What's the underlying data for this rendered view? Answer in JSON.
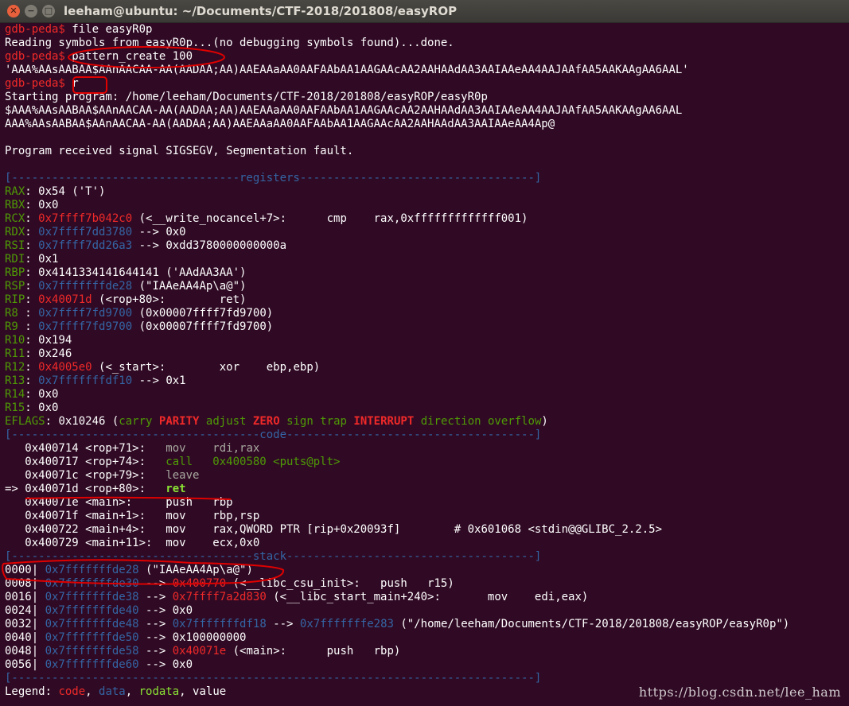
{
  "window": {
    "title": "leeham@ubuntu: ~/Documents/CTF-2018/201808/easyROP",
    "close_glyph": "✕",
    "minimize_glyph": "−",
    "maximize_glyph": "□"
  },
  "terminal": {
    "prompt": "gdb-peda$",
    "cmd1": "file easyR0p",
    "reading_symbols": "Reading symbols from easyR0p...(no debugging symbols found)...done.",
    "cmd2": "pattern_create 100",
    "pattern": "'AAA%AAsAABAA$AAnAACAA-AA(AADAA;AA)AAEAAaAA0AAFAAbAA1AAGAAcAA2AAHAAdAA3AAIAAeAA4AAJAAfAA5AAKAAgAA6AAL'",
    "cmd3": "r",
    "starting_program": "Starting program: /home/leeham/Documents/CTF-2018/201808/easyROP/easyR0p",
    "input_echo": "$AAA%AAsAABAA$AAnAACAA-AA(AADAA;AA)AAEAAaAA0AAFAAbAA1AAGAAcAA2AAHAAdAA3AAIAAeAA4AAJAAfAA5AAKAAgAA6AAL",
    "output_echo": "AAA%AAsAABAA$AAnAACAA-AA(AADAA;AA)AAEAAaAA0AAFAAbAA1AAGAAcAA2AAHAAdAA3AAIAAeAA4Ap@",
    "signal": "Program received signal SIGSEGV, Segmentation fault."
  },
  "sections": {
    "registers": "[----------------------------------registers-----------------------------------]",
    "code": "[-------------------------------------code-------------------------------------]",
    "stack": "[------------------------------------stack-------------------------------------]",
    "end": "[------------------------------------------------------------------------------]"
  },
  "registers": {
    "rax": {
      "name": "RAX",
      "val": "0x54 ('T')"
    },
    "rbx": {
      "name": "RBX",
      "val": "0x0"
    },
    "rcx": {
      "name": "RCX",
      "addr": "0x7ffff7b042c0",
      "rest": " (<__write_nocancel+7>:      cmp    rax,0xfffffffffffff001)"
    },
    "rdx": {
      "name": "RDX",
      "addr": "0x7ffff7dd3780",
      "rest": " --> 0x0"
    },
    "rsi": {
      "name": "RSI",
      "addr": "0x7ffff7dd26a3",
      "rest": " --> 0xdd3780000000000a"
    },
    "rdi": {
      "name": "RDI",
      "val": "0x1"
    },
    "rbp": {
      "name": "RBP",
      "val": "0x4141334141644141 ('AAdAA3AA')"
    },
    "rsp": {
      "name": "RSP",
      "addr": "0x7fffffffde28",
      "rest": " (\"IAAeAA4Ap\\a@\")"
    },
    "rip": {
      "name": "RIP",
      "addr": "0x40071d",
      "rest": " (<rop+80>:        ret)"
    },
    "r8": {
      "name": "R8 ",
      "addr": "0x7ffff7fd9700",
      "rest": " (0x00007ffff7fd9700)"
    },
    "r9": {
      "name": "R9 ",
      "addr": "0x7ffff7fd9700",
      "rest": " (0x00007ffff7fd9700)"
    },
    "r10": {
      "name": "R10",
      "val": "0x194"
    },
    "r11": {
      "name": "R11",
      "val": "0x246"
    },
    "r12": {
      "name": "R12",
      "addr": "0x4005e0",
      "rest": " (<_start>:        xor    ebp,ebp)"
    },
    "r13": {
      "name": "R13",
      "addr": "0x7fffffffdf10",
      "rest": " --> 0x1"
    },
    "r14": {
      "name": "R14",
      "val": "0x0"
    },
    "r15": {
      "name": "R15",
      "val": "0x0"
    },
    "eflags": {
      "name": "EFLAGS",
      "val": "0x10246 (",
      "carry": "carry",
      "parity": "PARITY",
      "adjust": "adjust",
      "zero": "ZERO",
      "sign": "sign",
      "trap": "trap",
      "interrupt": "INTERRUPT",
      "direction": "direction",
      "overflow": "overflow",
      "close": ")"
    }
  },
  "code": {
    "l1": {
      "left": "   0x400714 <rop+71>:   ",
      "insn": "mov    rdi,rax"
    },
    "l2": {
      "left": "   0x400717 <rop+74>:   ",
      "insn": "call   0x400580 <puts@plt>"
    },
    "l3": {
      "left": "   0x40071c <rop+79>:   ",
      "insn": "leave"
    },
    "l4": {
      "left": "=> 0x40071d <rop+80>:   ",
      "insn": "ret"
    },
    "l5": {
      "left": "   0x40071e <main>:     ",
      "insn": "push   rbp"
    },
    "l6": {
      "left": "   0x40071f <main+1>:   ",
      "insn": "mov    rbp,rsp"
    },
    "l7": {
      "left": "   0x400722 <main+4>:   ",
      "insn": "mov    rax,QWORD PTR [rip+0x20093f]        # 0x601068 <stdin@@GLIBC_2.2.5>"
    },
    "l8": {
      "left": "   0x400729 <main+11>:  ",
      "insn": "mov    ecx,0x0"
    }
  },
  "stack": {
    "s0": {
      "off": "0000| ",
      "addr": "0x7fffffffde28",
      "rest": " (\"IAAeAA4Ap\\a@\")"
    },
    "s1": {
      "off": "0008| ",
      "addr": "0x7fffffffde30",
      "arrow": " --> ",
      "val": "0x400770",
      "rest": " (<__libc_csu_init>:   push   r15)"
    },
    "s2": {
      "off": "0016| ",
      "addr": "0x7fffffffde38",
      "arrow": " --> ",
      "val": "0x7ffff7a2d830",
      "rest": " (<__libc_start_main+240>:       mov    edi,eax)"
    },
    "s3": {
      "off": "0024| ",
      "addr": "0x7fffffffde40",
      "rest": " --> 0x0"
    },
    "s4": {
      "off": "0032| ",
      "addr": "0x7fffffffde48",
      "arrow": " --> ",
      "val": "0x7fffffffdf18",
      "arrow2": " --> ",
      "val2": "0x7fffffffe283",
      "rest": " (\"/home/leeham/Documents/CTF-2018/201808/easyROP/easyR0p\")"
    },
    "s5": {
      "off": "0040| ",
      "addr": "0x7fffffffde50",
      "rest": " --> 0x100000000"
    },
    "s6": {
      "off": "0048| ",
      "addr": "0x7fffffffde58",
      "arrow": " --> ",
      "val": "0x40071e",
      "rest": " (<main>:      push   rbp)"
    },
    "s7": {
      "off": "0056| ",
      "addr": "0x7fffffffde60",
      "rest": " --> 0x0"
    }
  },
  "legend": {
    "label": "Legend: ",
    "code": "code",
    "sep1": ", ",
    "data": "data",
    "sep2": ", ",
    "rodata": "rodata",
    "sep3": ", ",
    "value": "value"
  },
  "watermark": "https://blog.csdn.net/lee_ham",
  "colors": {
    "background": "#300a24",
    "prompt": "#ef2929",
    "code": "#ef2929",
    "data": "#3465a4",
    "rodata": "#8ae234",
    "annotation": "#e00000"
  }
}
